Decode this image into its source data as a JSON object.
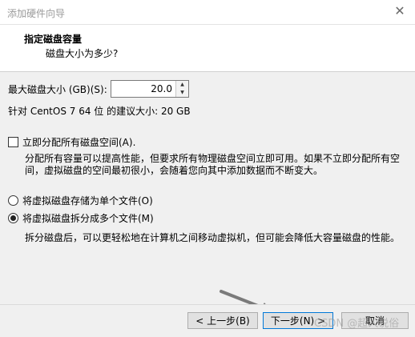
{
  "window": {
    "title": "添加硬件向导",
    "close_icon": "close-icon"
  },
  "header": {
    "title": "指定磁盘容量",
    "subtitle": "磁盘大小为多少?"
  },
  "size": {
    "label": "最大磁盘大小 (GB)(S):",
    "value": "20.0"
  },
  "recommendation": "针对 CentOS 7 64 位 的建议大小: 20 GB",
  "allocate": {
    "label": "立即分配所有磁盘空间(A).",
    "checked": false,
    "description": "分配所有容量可以提高性能，但要求所有物理磁盘空间立即可用。如果不立即分配所有空间，虚拟磁盘的空间最初很小，会随着您向其中添加数据而不断变大。"
  },
  "storage_options": [
    {
      "label": "将虚拟磁盘存储为单个文件(O)",
      "selected": false
    },
    {
      "label": "将虚拟磁盘拆分成多个文件(M)",
      "selected": true
    }
  ],
  "split_description": "拆分磁盘后，可以更轻松地在计算机之间移动虚拟机，但可能会降低大容量磁盘的性能。",
  "buttons": {
    "back": "< 上一步(B)",
    "next": "下一步(N) >",
    "cancel": "取消"
  },
  "watermark": "CSDN @超人说俗"
}
